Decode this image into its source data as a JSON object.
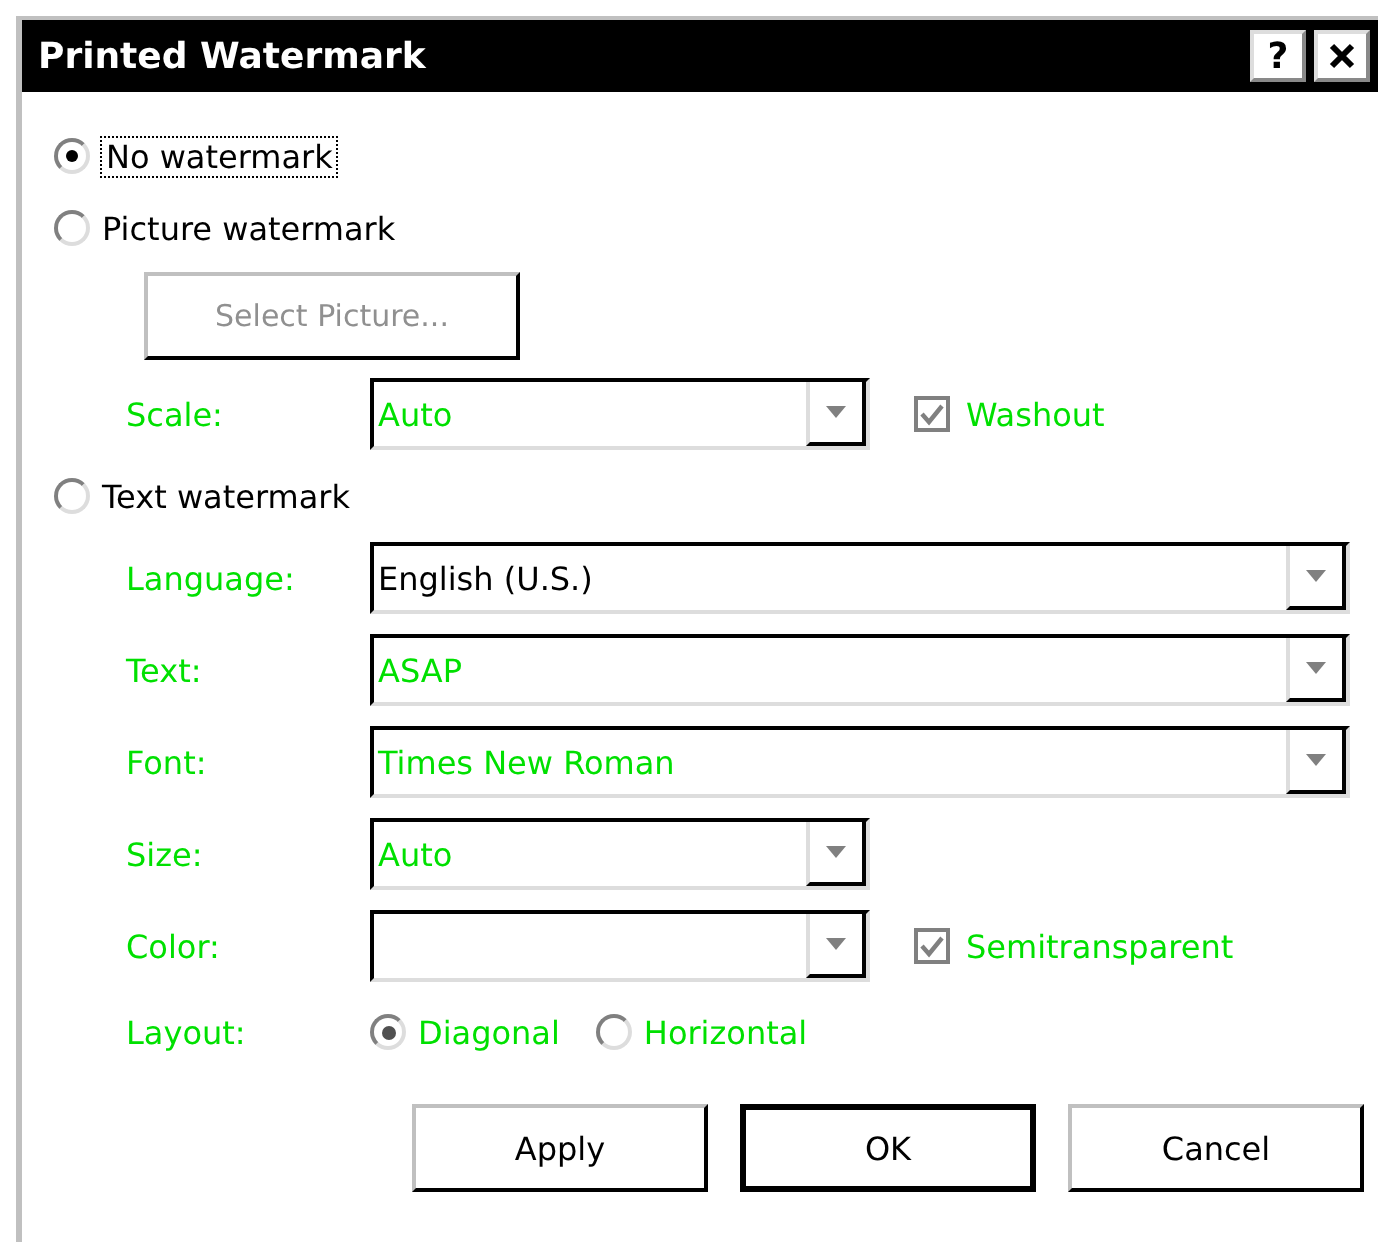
{
  "window": {
    "title": "Printed Watermark",
    "help_button": "?"
  },
  "no_watermark": {
    "label": "No watermark",
    "selected": true
  },
  "picture_watermark": {
    "label": "Picture watermark",
    "selected": false,
    "select_button": {
      "label": "Select Picture...",
      "disabled": true
    },
    "scale": {
      "label": "Scale:",
      "value": "Auto"
    },
    "washout": {
      "label": "Washout",
      "checked": true
    }
  },
  "text_watermark": {
    "label": "Text watermark",
    "selected": false,
    "fields": [
      {
        "label": "Language:",
        "value": "English (U.S.)",
        "kind": "wide",
        "disabled": false
      },
      {
        "label": "Text:",
        "value": "ASAP",
        "kind": "wide",
        "disabled": true
      },
      {
        "label": "Font:",
        "value": "Times New Roman",
        "kind": "wide",
        "disabled": true
      },
      {
        "label": "Size:",
        "value": "Auto",
        "kind": "short",
        "disabled": true
      },
      {
        "label": "Color:",
        "kind": "short"
      }
    ],
    "semitransparent": {
      "label": "Semitransparent",
      "checked": true
    },
    "layout": {
      "label": "Layout:",
      "options": [
        {
          "label": "Diagonal",
          "selected": true
        },
        {
          "label": "Horizontal",
          "selected": false
        }
      ]
    }
  },
  "buttons": [
    {
      "label": "Apply",
      "default": false
    },
    {
      "label": "OK",
      "default": true
    },
    {
      "label": "Cancel",
      "default": false
    }
  ]
}
